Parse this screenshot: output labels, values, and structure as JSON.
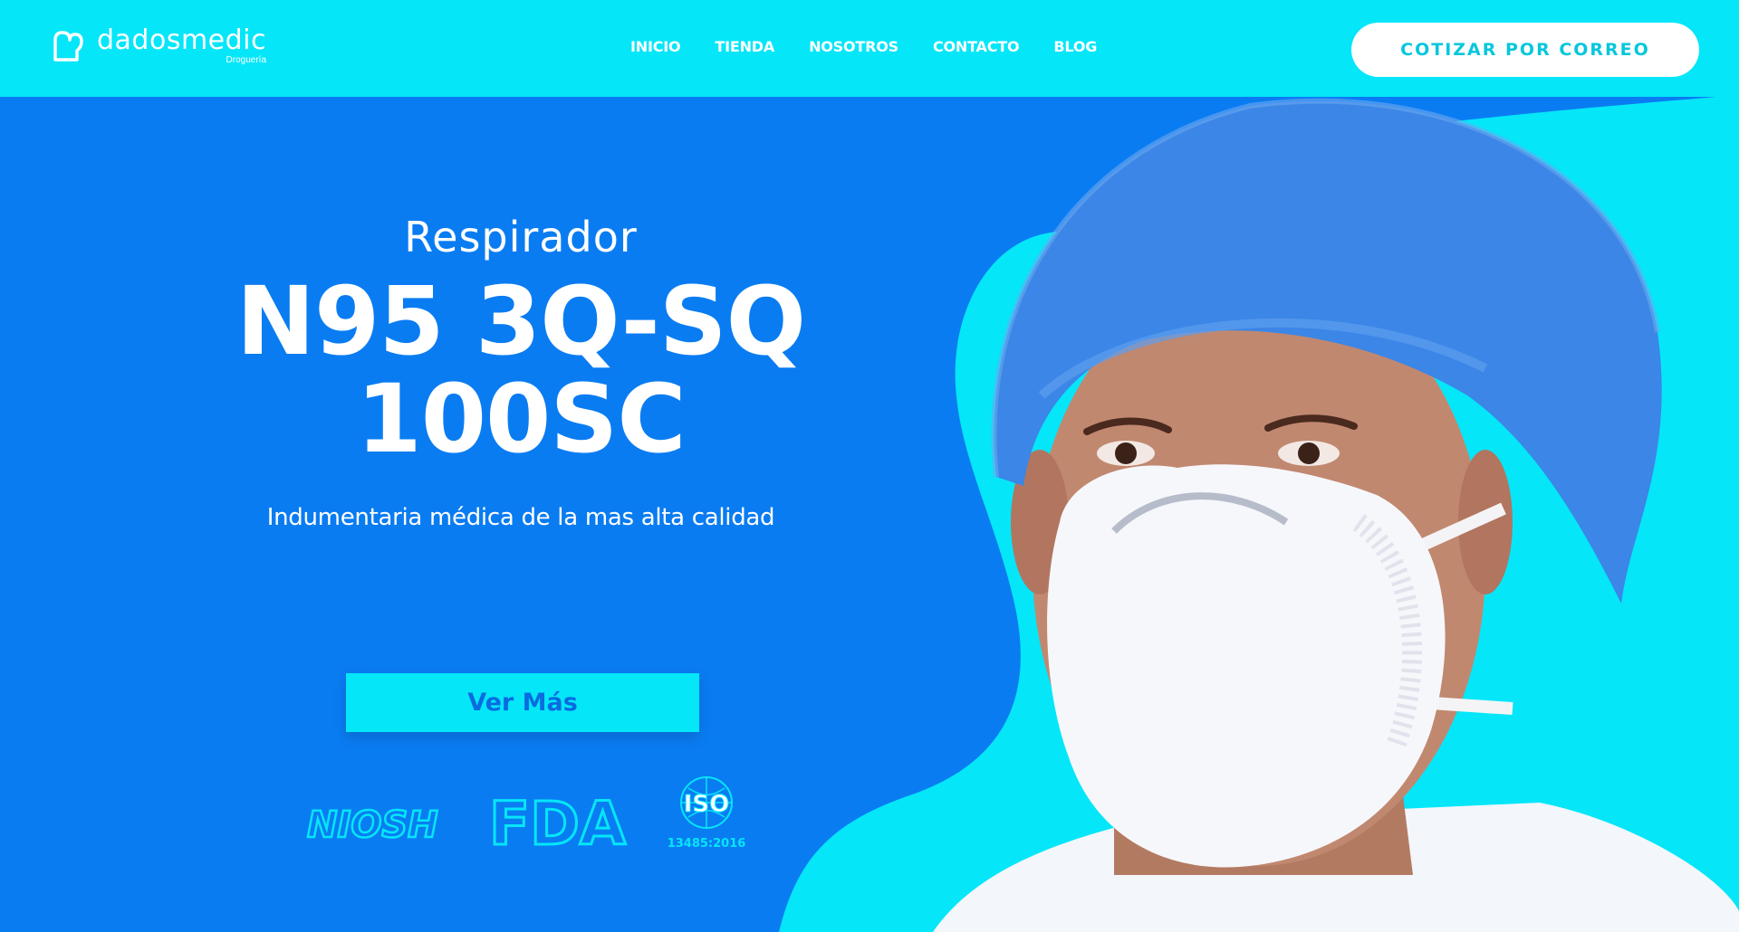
{
  "brand": {
    "name": "dadosmedic",
    "subtitle": "Droguería",
    "icon": "heart-outline-icon"
  },
  "nav": {
    "items": [
      "INICIO",
      "TIENDA",
      "NOSOTROS",
      "CONTACTO",
      "BLOG"
    ]
  },
  "header_cta": "COTIZAR POR CORREO",
  "hero": {
    "pre_title": "Respirador",
    "title_line1": "N95 3Q-SQ",
    "title_line2": "100SC",
    "subtitle": "Indumentaria médica de la mas alta calidad",
    "button_label": "Ver Más",
    "certifications": [
      "NIOSH",
      "FDA",
      "ISO 13485:2016"
    ]
  },
  "colors": {
    "header_bg": "#05e6f9",
    "hero_bg": "#0a7cf2",
    "accent_cyan": "#05e6f9",
    "white": "#ffffff"
  }
}
